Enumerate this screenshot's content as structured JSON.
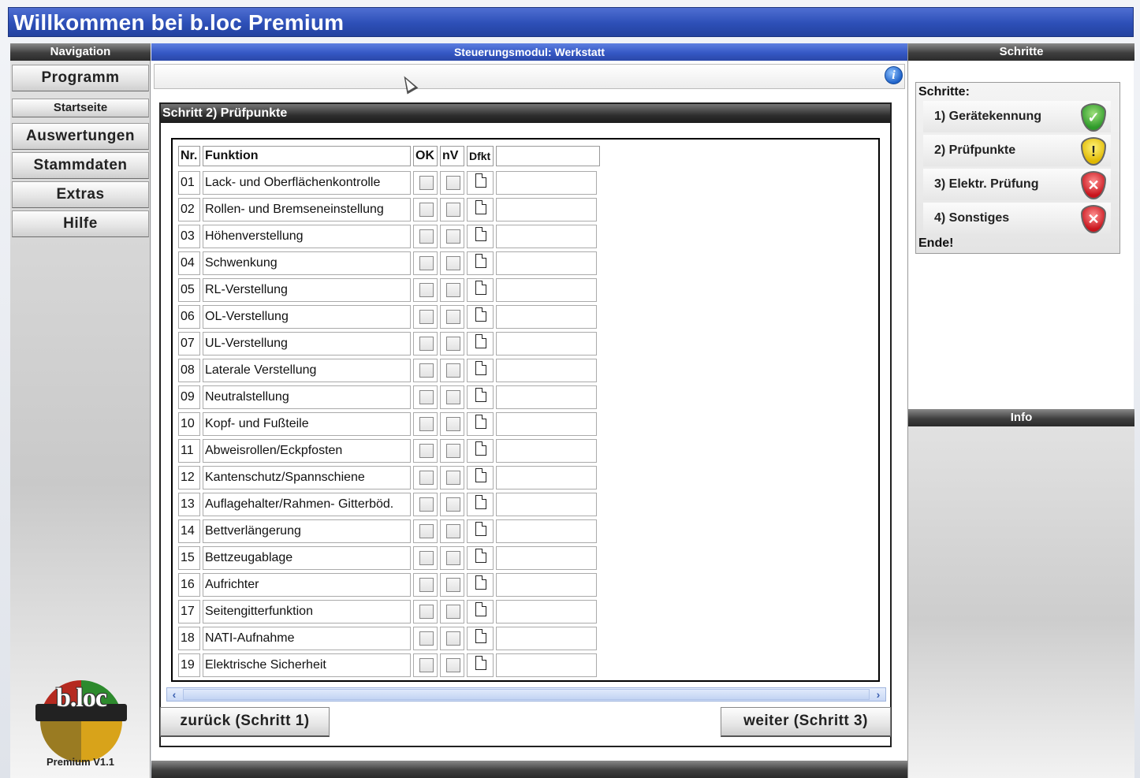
{
  "window": {
    "title": "Willkommen bei b.loc Premium"
  },
  "nav": {
    "header": "Navigation",
    "items": [
      {
        "label": "Programm",
        "size": "big"
      },
      {
        "label": "Startseite",
        "size": "small"
      },
      {
        "label": "Auswertungen",
        "size": "big"
      },
      {
        "label": "Stammdaten",
        "size": "big"
      },
      {
        "label": "Extras",
        "size": "big"
      },
      {
        "label": "Hilfe",
        "size": "big"
      }
    ],
    "logo_text": "b.loc",
    "version": "Premium V1.1"
  },
  "main": {
    "header": "Steuerungsmodul: Werkstatt",
    "info_icon": "info-icon",
    "panel_title": "Schritt 2) Prüfpunkte",
    "columns": [
      "Nr.",
      "Funktion",
      "OK",
      "nV",
      "Dfkt",
      ""
    ],
    "rows": [
      {
        "nr": "01",
        "funktion": "Lack- und Oberflächenkontrolle"
      },
      {
        "nr": "02",
        "funktion": "Rollen- und Bremseneinstellung"
      },
      {
        "nr": "03",
        "funktion": "Höhenverstellung"
      },
      {
        "nr": "04",
        "funktion": "Schwenkung"
      },
      {
        "nr": "05",
        "funktion": "RL-Verstellung"
      },
      {
        "nr": "06",
        "funktion": "OL-Verstellung"
      },
      {
        "nr": "07",
        "funktion": "UL-Verstellung"
      },
      {
        "nr": "08",
        "funktion": "Laterale Verstellung"
      },
      {
        "nr": "09",
        "funktion": "Neutralstellung"
      },
      {
        "nr": "10",
        "funktion": "Kopf- und Fußteile"
      },
      {
        "nr": "11",
        "funktion": "Abweisrollen/Eckpfosten"
      },
      {
        "nr": "12",
        "funktion": "Kantenschutz/Spannschiene"
      },
      {
        "nr": "13",
        "funktion": "Auflagehalter/Rahmen- Gitterböd."
      },
      {
        "nr": "14",
        "funktion": "Bettverlängerung"
      },
      {
        "nr": "15",
        "funktion": "Bettzeugablage"
      },
      {
        "nr": "16",
        "funktion": "Aufrichter"
      },
      {
        "nr": "17",
        "funktion": "Seitengitterfunktion"
      },
      {
        "nr": "18",
        "funktion": "NATI-Aufnahme"
      },
      {
        "nr": "19",
        "funktion": "Elektrische Sicherheit"
      }
    ],
    "back_button": "zurück (Schritt 1)",
    "next_button": "weiter (Schritt 3)"
  },
  "steps": {
    "header": "Schritte",
    "caption": "Schritte:",
    "items": [
      {
        "label": "1) Gerätekennung",
        "status": "ok",
        "icon": "shield-check-icon"
      },
      {
        "label": "2) Prüfpunkte",
        "status": "warn",
        "icon": "shield-warning-icon"
      },
      {
        "label": "3) Elektr. Prüfung",
        "status": "err",
        "icon": "shield-error-icon"
      },
      {
        "label": "4) Sonstiges",
        "status": "err",
        "icon": "shield-error-icon"
      }
    ],
    "end": "Ende!"
  },
  "info": {
    "header": "Info"
  },
  "colors": {
    "title_blue": "#2d4fb7",
    "header_dark": "#3f3f3f",
    "ok": "#2e9a2a",
    "warn": "#e0b800",
    "err": "#c8141c"
  }
}
